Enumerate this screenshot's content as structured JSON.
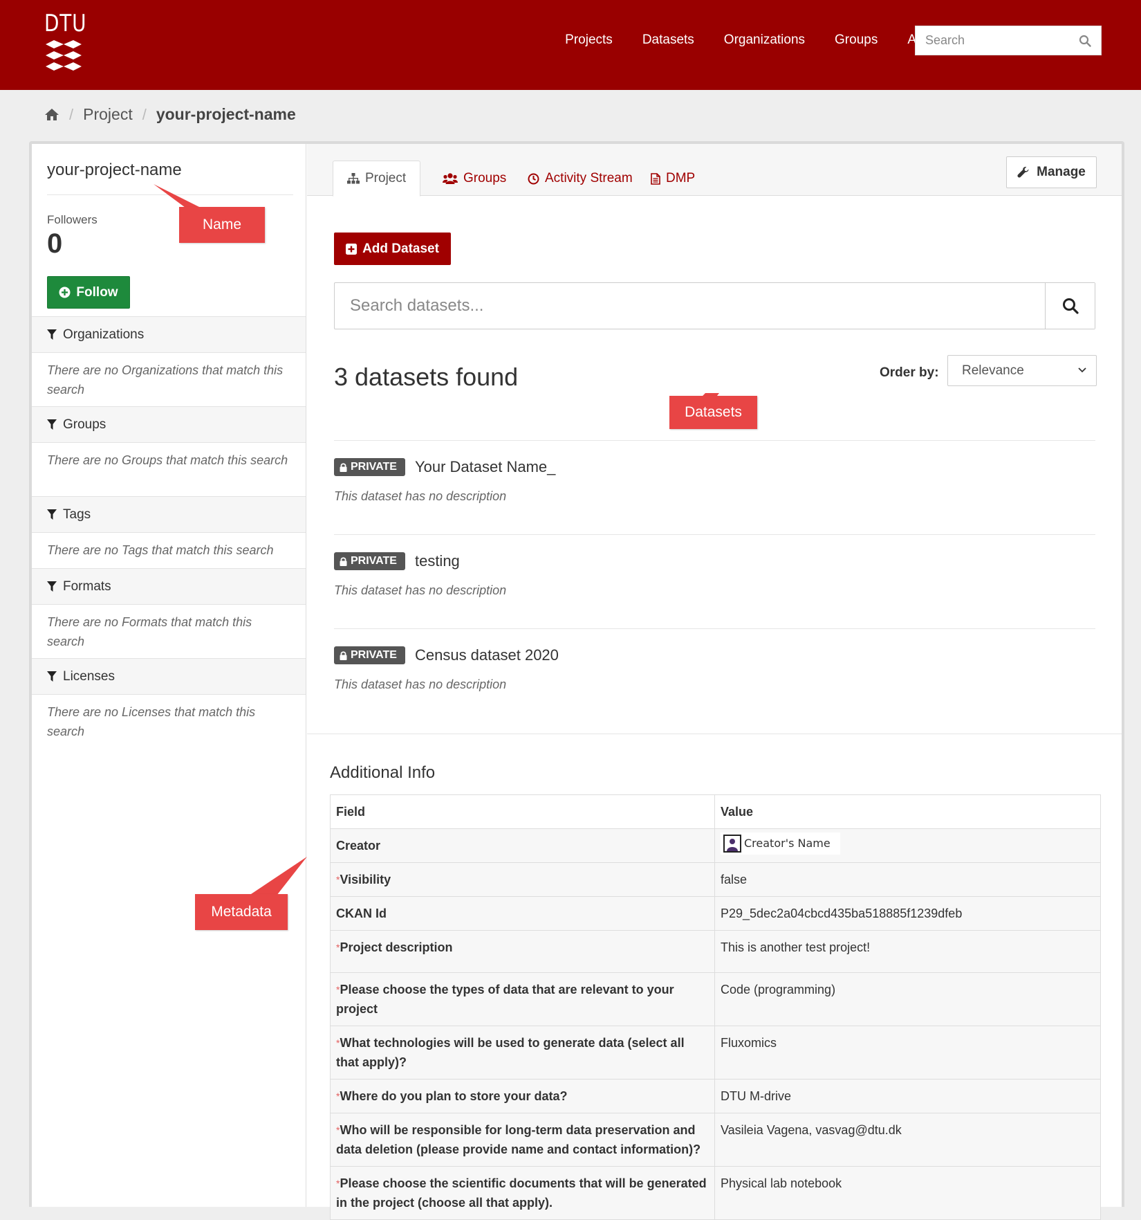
{
  "header": {
    "logo_text": "DTU",
    "nav": [
      "Projects",
      "Datasets",
      "Organizations",
      "Groups",
      "About"
    ],
    "search_placeholder": "Search"
  },
  "breadcrumb": {
    "home_icon": "home-icon",
    "items": [
      "Project",
      "your-project-name"
    ]
  },
  "sidebar": {
    "title": "your-project-name",
    "followers_label": "Followers",
    "followers_count": "0",
    "follow_label": "Follow",
    "facets": [
      {
        "title": "Organizations",
        "empty": "There are no Organizations that match this search"
      },
      {
        "title": "Groups",
        "empty": "There are no Groups that match this search"
      },
      {
        "title": "Tags",
        "empty": "There are no Tags that match this search"
      },
      {
        "title": "Formats",
        "empty": "There are no Formats that match this search"
      },
      {
        "title": "Licenses",
        "empty": "There are no Licenses that match this search"
      }
    ]
  },
  "tabs": [
    {
      "label": "Project",
      "icon": "sitemap-icon",
      "active": true
    },
    {
      "label": "Groups",
      "icon": "users-icon"
    },
    {
      "label": "Activity Stream",
      "icon": "clock-icon"
    },
    {
      "label": "DMP",
      "icon": "document-icon"
    }
  ],
  "manage_label": "Manage",
  "add_dataset_label": "Add Dataset",
  "dataset_search_placeholder": "Search datasets...",
  "results_title": "3 datasets found",
  "order_label": "Order by:",
  "order_value": "Relevance",
  "datasets": [
    {
      "badge": "PRIVATE",
      "name": "Your Dataset Name_",
      "desc": "This dataset has no description"
    },
    {
      "badge": "PRIVATE",
      "name": "testing",
      "desc": "This dataset has no description"
    },
    {
      "badge": "PRIVATE",
      "name": "Census dataset 2020",
      "desc": "This dataset has no description"
    }
  ],
  "additional_info": {
    "title": "Additional Info",
    "headers": [
      "Field",
      "Value"
    ],
    "rows": [
      {
        "field": "Creator",
        "value": "Creator's Name",
        "required": false
      },
      {
        "field": "Visibility",
        "value": "false",
        "required": true
      },
      {
        "field": "CKAN Id",
        "value": "P29_5dec2a04cbcd435ba518885f1239dfeb",
        "required": false
      },
      {
        "field": "Project description",
        "value": "This is another test project!",
        "required": true
      },
      {
        "field": "Please choose the types of data that are relevant to your project",
        "value": "Code (programming)",
        "required": true
      },
      {
        "field": "What technologies will be used to generate data (select all that apply)?",
        "value": "Fluxomics",
        "required": true
      },
      {
        "field": "Where do you plan to store your data?",
        "value": "DTU M-drive",
        "required": true
      },
      {
        "field": "Who will be responsible for long-term data preservation and data deletion (please provide name and contact information)?",
        "value": "Vasileia Vagena, vasvag@dtu.dk",
        "required": true
      },
      {
        "field": "Please choose the scientific documents that will be generated in the project (choose all that apply).",
        "value": "Physical lab notebook",
        "required": true
      }
    ]
  },
  "annotations": [
    "Name",
    "Datasets",
    "Metadata"
  ],
  "colors": {
    "brand": "#990000",
    "link": "#a00000",
    "follow": "#1e8a3c",
    "badge": "#555555",
    "callout": "#e84545"
  }
}
